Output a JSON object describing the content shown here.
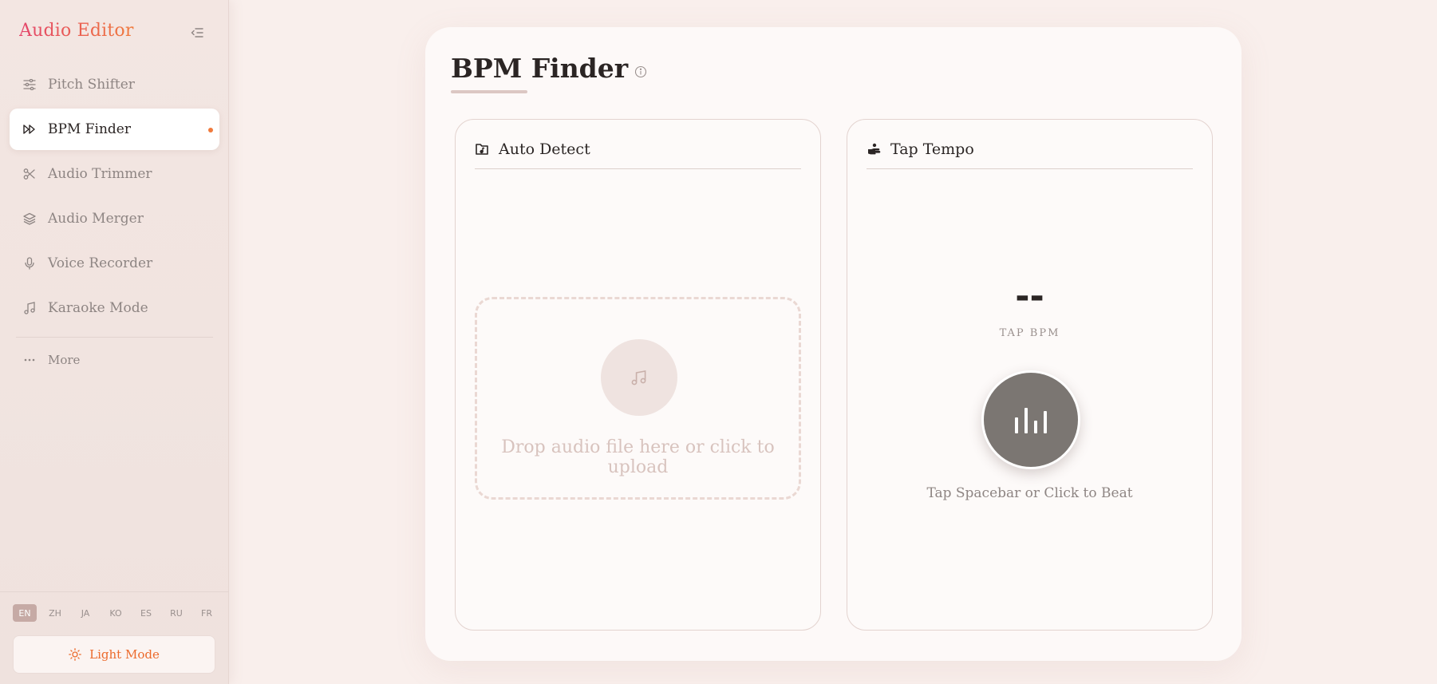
{
  "sidebar": {
    "brand": "Audio Editor",
    "items": [
      {
        "label": "Pitch Shifter",
        "icon": "sliders-icon"
      },
      {
        "label": "BPM Finder",
        "icon": "fast-forward-icon",
        "active": true
      },
      {
        "label": "Audio Trimmer",
        "icon": "scissors-icon"
      },
      {
        "label": "Audio Merger",
        "icon": "layers-icon"
      },
      {
        "label": "Voice Recorder",
        "icon": "microphone-icon"
      },
      {
        "label": "Karaoke Mode",
        "icon": "music-note-icon"
      }
    ],
    "more_label": "More",
    "languages": [
      "EN",
      "ZH",
      "JA",
      "KO",
      "ES",
      "RU",
      "FR"
    ],
    "active_language": "EN",
    "mode_label": "Light Mode"
  },
  "main": {
    "title": "BPM Finder",
    "auto_detect": {
      "title": "Auto Detect",
      "dropzone_text": "Drop audio file here or click to upload"
    },
    "tap_tempo": {
      "title": "Tap Tempo",
      "bpm_value": "--",
      "bpm_label": "TAP BPM",
      "hint": "Tap Spacebar or Click to Beat"
    }
  },
  "colors": {
    "accent_orange": "#f07a3c",
    "brand_pink": "#e4456b",
    "tap_button": "#7b7672"
  }
}
